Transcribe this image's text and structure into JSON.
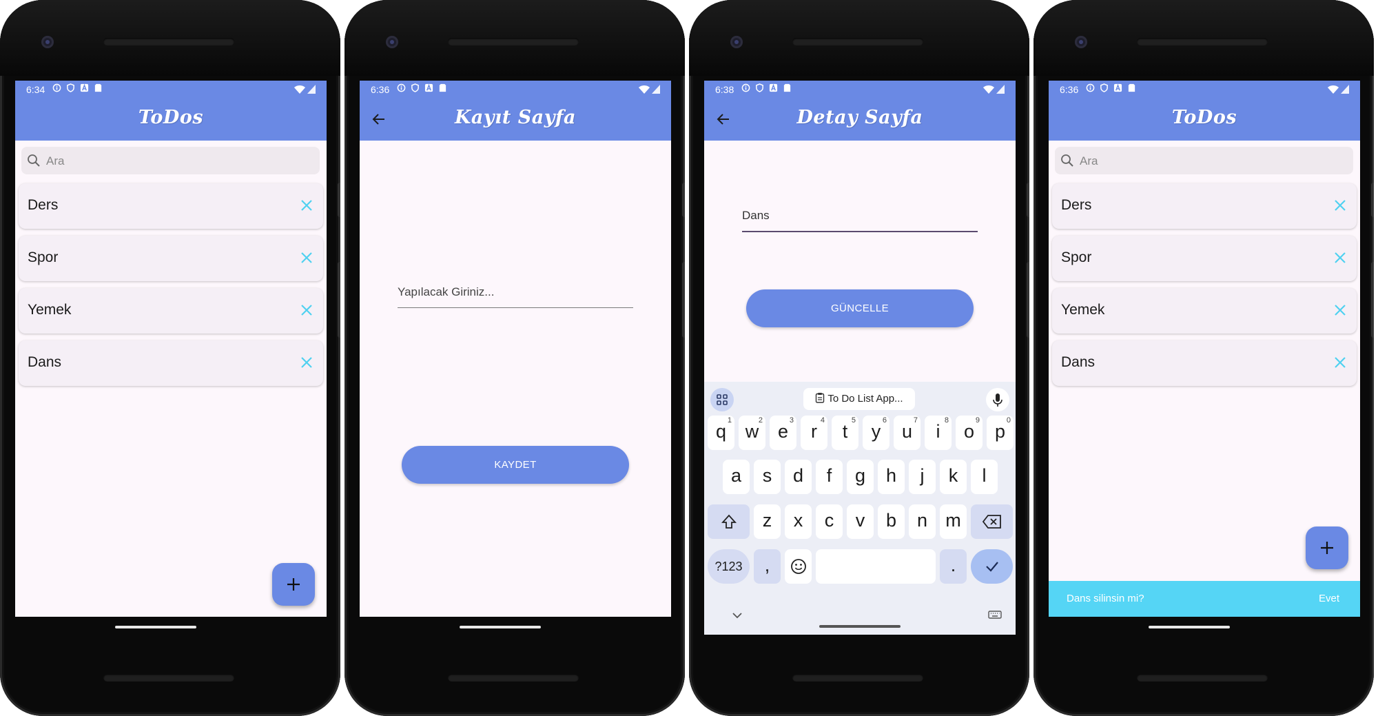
{
  "phones": [
    {
      "status": {
        "time": "6:34"
      },
      "title": "ToDos",
      "search": {
        "placeholder": "Ara"
      },
      "todos": [
        "Ders",
        "Spor",
        "Yemek",
        "Dans"
      ],
      "fab_label": "+"
    },
    {
      "status": {
        "time": "6:36"
      },
      "title": "Kayıt Sayfa",
      "field": {
        "placeholder": "Yapılacak Giriniz..."
      },
      "button_label": "KAYDET"
    },
    {
      "status": {
        "time": "6:38"
      },
      "title": "Detay Sayfa",
      "field": {
        "value": "Dans"
      },
      "button_label": "GÜNCELLE",
      "keyboard": {
        "suggestion_chip": "To Do List App...",
        "row1": [
          {
            "k": "q",
            "n": "1"
          },
          {
            "k": "w",
            "n": "2"
          },
          {
            "k": "e",
            "n": "3"
          },
          {
            "k": "r",
            "n": "4"
          },
          {
            "k": "t",
            "n": "5"
          },
          {
            "k": "y",
            "n": "6"
          },
          {
            "k": "u",
            "n": "7"
          },
          {
            "k": "i",
            "n": "8"
          },
          {
            "k": "o",
            "n": "9"
          },
          {
            "k": "p",
            "n": "0"
          }
        ],
        "row2": [
          "a",
          "s",
          "d",
          "f",
          "g",
          "h",
          "j",
          "k",
          "l"
        ],
        "row3": [
          "z",
          "x",
          "c",
          "v",
          "b",
          "n",
          "m"
        ],
        "symbols_label": "?123",
        "comma_label": ",",
        "period_label": "."
      }
    },
    {
      "status": {
        "time": "6:36"
      },
      "title": "ToDos",
      "search": {
        "placeholder": "Ara"
      },
      "todos": [
        "Ders",
        "Spor",
        "Yemek",
        "Dans"
      ],
      "fab_label": "+",
      "snackbar": {
        "message": "Dans silinsin mi?",
        "action": "Evet"
      }
    }
  ],
  "colors": {
    "primary": "#6a89e4",
    "background": "#fdf7fc",
    "card": "#f5eff6",
    "delete_icon": "#4fd1f0",
    "snackbar": "#55d5f5",
    "keyboard_bg": "#eceef6"
  },
  "icons": [
    "search-icon",
    "close-icon",
    "back-arrow-icon",
    "plus-icon",
    "mic-icon",
    "apps-grid-icon",
    "clipboard-icon",
    "shift-icon",
    "backspace-icon",
    "emoji-icon",
    "check-icon",
    "chevron-down-icon",
    "keyboard-icon",
    "wifi-icon",
    "signal-icon",
    "info-icon",
    "shield-icon",
    "sim-icon"
  ]
}
